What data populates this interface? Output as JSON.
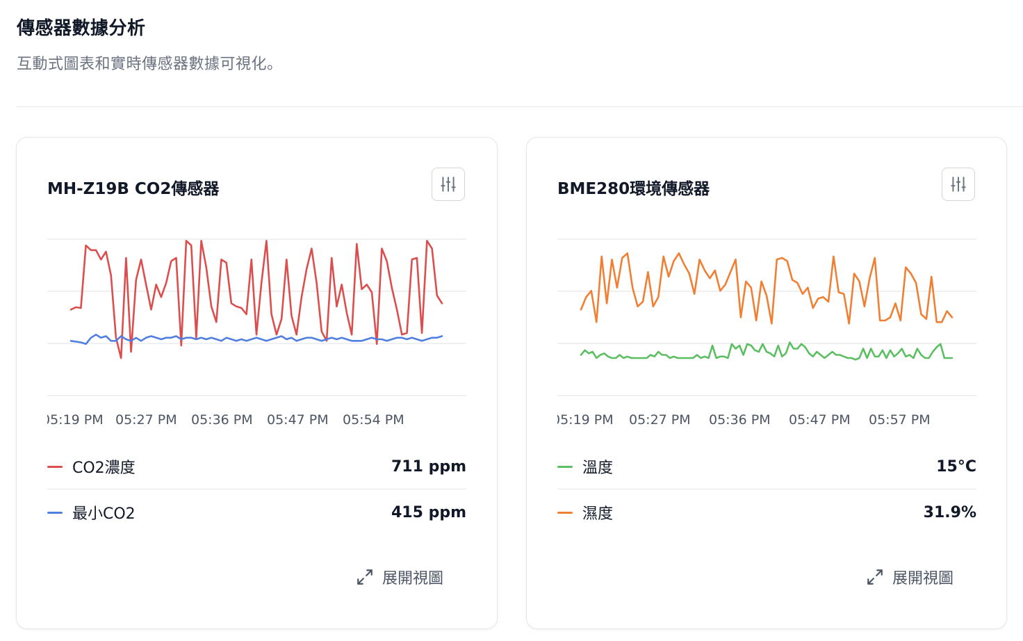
{
  "header": {
    "title": "傳感器數據分析",
    "subtitle": "互動式圖表和實時傳感器數據可視化。"
  },
  "cards": [
    {
      "title": "MH-Z19B CO2傳感器",
      "expand_label": "展開視圖",
      "legend": [
        {
          "name": "CO2濃度",
          "value": "711 ppm",
          "color": "#dc4e4e"
        },
        {
          "name": "最小CO2",
          "value": "415 ppm",
          "color": "#4f7fe0"
        }
      ]
    },
    {
      "title": "BME280環境傳感器",
      "expand_label": "展開視圖",
      "legend": [
        {
          "name": "溫度",
          "value": "15°C",
          "color": "#5bbf62"
        },
        {
          "name": "濕度",
          "value": "31.9%",
          "color": "#f07f33"
        }
      ]
    }
  ],
  "chart_data": [
    {
      "type": "line",
      "x_tick_labels": [
        "05:19 PM",
        "05:27 PM",
        "05:36 PM",
        "05:47 PM",
        "05:54 PM"
      ],
      "y_gridlines": 4,
      "series": [
        {
          "name": "CO2濃度",
          "color": "#dc4e4e",
          "values": [
            0.55,
            0.565,
            0.56,
            0.96,
            0.93,
            0.93,
            0.87,
            0.92,
            0.77,
            0.37,
            0.24,
            0.88,
            0.28,
            0.74,
            0.87,
            0.71,
            0.55,
            0.71,
            0.63,
            0.72,
            0.86,
            0.88,
            0.32,
            0.99,
            0.96,
            0.37,
            0.99,
            0.82,
            0.57,
            0.47,
            0.87,
            0.85,
            0.59,
            0.57,
            0.56,
            0.52,
            0.87,
            0.39,
            0.72,
            0.99,
            0.52,
            0.39,
            0.49,
            0.87,
            0.51,
            0.39,
            0.63,
            0.81,
            0.94,
            0.72,
            0.41,
            0.35,
            0.88,
            0.57,
            0.71,
            0.53,
            0.39,
            0.97,
            0.68,
            0.71,
            0.66,
            0.33,
            0.94,
            0.86,
            0.69,
            0.55,
            0.39,
            0.4,
            0.87,
            0.88,
            0.4,
            0.99,
            0.94,
            0.64,
            0.59
          ],
          "baseline": "cycle"
        },
        {
          "name": "最小CO2",
          "color": "#4f7fe0",
          "values": [
            0.35,
            0.345,
            0.34,
            0.33,
            0.37,
            0.39,
            0.37,
            0.38,
            0.35,
            0.35,
            0.38,
            0.36,
            0.35,
            0.37,
            0.35,
            0.37,
            0.38,
            0.37,
            0.36,
            0.37,
            0.37,
            0.38,
            0.36,
            0.37,
            0.37,
            0.36,
            0.37,
            0.36,
            0.37,
            0.36,
            0.35,
            0.37,
            0.36,
            0.35,
            0.36,
            0.35,
            0.36,
            0.37,
            0.36,
            0.35,
            0.36,
            0.37,
            0.38,
            0.36,
            0.37,
            0.35,
            0.36,
            0.37,
            0.37,
            0.36,
            0.35,
            0.36,
            0.37,
            0.36,
            0.37,
            0.36,
            0.35,
            0.35,
            0.35,
            0.36,
            0.37,
            0.36,
            0.36,
            0.35,
            0.36,
            0.37,
            0.37,
            0.36,
            0.37,
            0.36,
            0.35,
            0.36,
            0.37,
            0.37,
            0.38
          ],
          "baseline": "cycle"
        }
      ]
    },
    {
      "type": "line",
      "x_tick_labels": [
        "05:19 PM",
        "05:27 PM",
        "05:36 PM",
        "05:47 PM",
        "05:57 PM"
      ],
      "y_gridlines": 4,
      "series": [
        {
          "name": "濕度",
          "color": "#f07f33",
          "values": [
            0.55,
            0.63,
            0.67,
            0.47,
            0.89,
            0.59,
            0.87,
            0.69,
            0.88,
            0.91,
            0.69,
            0.57,
            0.6,
            0.79,
            0.57,
            0.63,
            0.89,
            0.76,
            0.86,
            0.91,
            0.84,
            0.78,
            0.65,
            0.87,
            0.8,
            0.75,
            0.8,
            0.67,
            0.71,
            0.79,
            0.87,
            0.5,
            0.73,
            0.69,
            0.48,
            0.73,
            0.64,
            0.46,
            0.87,
            0.88,
            0.86,
            0.74,
            0.72,
            0.65,
            0.69,
            0.56,
            0.62,
            0.63,
            0.6,
            0.89,
            0.66,
            0.65,
            0.46,
            0.78,
            0.73,
            0.57,
            0.75,
            0.88,
            0.48,
            0.48,
            0.5,
            0.59,
            0.48,
            0.82,
            0.78,
            0.72,
            0.52,
            0.49,
            0.76,
            0.47,
            0.47,
            0.54,
            0.5
          ],
          "baseline": "cycle"
        },
        {
          "name": "溫度",
          "color": "#5bbf62",
          "values": [
            0.26,
            0.29,
            0.27,
            0.28,
            0.24,
            0.26,
            0.27,
            0.25,
            0.24,
            0.24,
            0.26,
            0.24,
            0.25,
            0.24,
            0.24,
            0.24,
            0.24,
            0.24,
            0.26,
            0.25,
            0.28,
            0.26,
            0.26,
            0.24,
            0.25,
            0.24,
            0.24,
            0.24,
            0.24,
            0.24,
            0.26,
            0.24,
            0.25,
            0.24,
            0.32,
            0.24,
            0.25,
            0.25,
            0.24,
            0.33,
            0.3,
            0.32,
            0.26,
            0.33,
            0.32,
            0.29,
            0.28,
            0.33,
            0.28,
            0.27,
            0.25,
            0.32,
            0.25,
            0.27,
            0.34,
            0.3,
            0.3,
            0.33,
            0.31,
            0.27,
            0.25,
            0.28,
            0.26,
            0.24,
            0.26,
            0.28,
            0.26,
            0.26,
            0.25,
            0.24,
            0.24,
            0.23,
            0.24,
            0.3,
            0.24,
            0.3,
            0.25,
            0.25,
            0.29,
            0.24,
            0.29,
            0.25,
            0.27,
            0.3,
            0.25,
            0.26,
            0.24,
            0.3,
            0.26,
            0.24,
            0.24,
            0.28,
            0.31,
            0.33,
            0.24,
            0.24,
            0.24
          ],
          "baseline": "cycle"
        }
      ]
    }
  ]
}
